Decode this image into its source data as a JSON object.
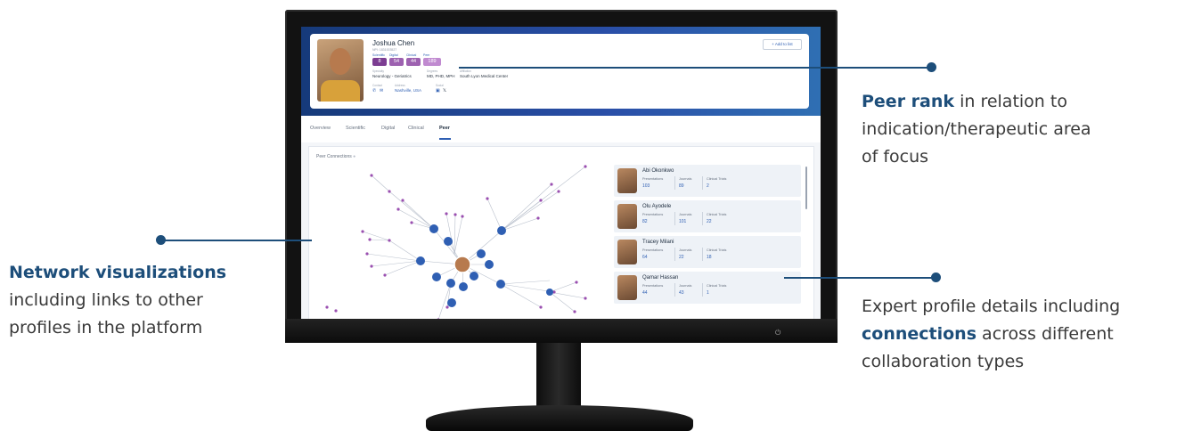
{
  "profile": {
    "name": "Joshua Chen",
    "npi": "NPI: 1831003527",
    "add_to_list": "+ Add to list",
    "scores": [
      {
        "label": "Scientific",
        "value": "8",
        "color": "#7c3d92"
      },
      {
        "label": "Digital",
        "value": "54",
        "color": "#9d61b0"
      },
      {
        "label": "Clinical",
        "value": "44",
        "color": "#9d61b0"
      },
      {
        "label": "Peer",
        "value": "189",
        "color": "#c08ad0"
      }
    ],
    "specialty_label": "Specialty",
    "specialty": "Neurology - Geriatrics",
    "degrees_label": "Degrees",
    "degrees": "MD, PHD, MPH",
    "affiliation_label": "Affiliation",
    "affiliation": "South Lyon Medical Center",
    "contact_label": "Contact",
    "address_label": "Address",
    "address": "Nashville, USA",
    "social_label": "Social"
  },
  "tabs": [
    "Overview",
    "Scientific",
    "Digital",
    "Clinical",
    "Peer"
  ],
  "active_tab": "Peer",
  "peer_panel": {
    "title": "Peer Connections",
    "columns": [
      "Presentations",
      "Journals",
      "Clinical Trials"
    ],
    "people": [
      {
        "name": "Abi Okonkwo",
        "values": [
          "103",
          "89",
          "2"
        ]
      },
      {
        "name": "Olu Ayodele",
        "values": [
          "82",
          "101",
          "22"
        ]
      },
      {
        "name": "Tracey Milani",
        "values": [
          "64",
          "22",
          "18"
        ]
      },
      {
        "name": "Qamar Hassan",
        "values": [
          "44",
          "43",
          "1"
        ]
      }
    ]
  },
  "callouts": {
    "peer_rank_bold": "Peer rank",
    "peer_rank_rest_1": " in relation to",
    "peer_rank_rest_2": "indication/therapeutic area",
    "peer_rank_rest_3": "of focus",
    "network_bold": "Network visualizations",
    "network_rest_1": "including links to other",
    "network_rest_2": "profiles in the platform",
    "expert_1": "Expert profile details including",
    "expert_bold": "connections",
    "expert_2": " across different",
    "expert_3": "collaboration types"
  },
  "colors": {
    "accent": "#1d4e7a",
    "node_blue": "#2f5fb3",
    "node_purple": "#9a4fb0"
  }
}
